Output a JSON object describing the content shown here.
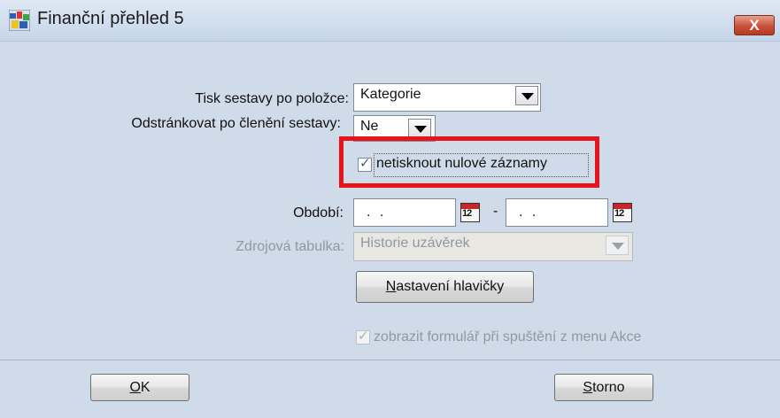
{
  "window": {
    "title": "Finanční přehled 5",
    "close_label": "X"
  },
  "form": {
    "tisk_label": "Tisk sestavy po položce:",
    "tisk_value": "Kategorie",
    "odstrankovat_label": "Odstránkovat po členění sestavy:",
    "odstrankovat_value": "Ne",
    "netisknout_label": "netisknout nulové záznamy",
    "netisknout_checked": true,
    "obdobi_label": "Období:",
    "date_from": ". .",
    "date_to": ". .",
    "date_separator": "-",
    "calendar_icon_text": "12",
    "zdroj_label": "Zdrojová tabulka:",
    "zdroj_value": "Historie uzávěrek",
    "header_button_prefix": "N",
    "header_button_rest": "astavení hlavičky",
    "zobrazit_label": "zobrazit formulář při spuštění z menu Akce",
    "zobrazit_checked": true
  },
  "buttons": {
    "ok_u": "O",
    "ok_rest": "K",
    "storno_u": "S",
    "storno_rest": "torno"
  },
  "colors": {
    "highlight": "#e8141c",
    "close_button": "#c9503a",
    "window_bg": "#cfdbe9"
  }
}
